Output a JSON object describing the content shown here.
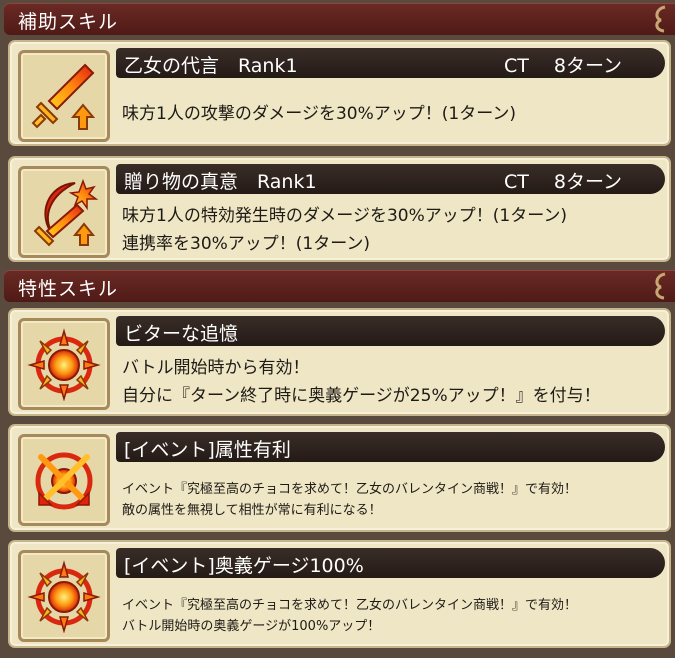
{
  "support_section": {
    "title": "補助スキル",
    "skills": [
      {
        "name": "乙女の代言　Rank1",
        "ct": "CT　 8ターン",
        "icon": "sword-up-icon",
        "description": [
          "味方1人の攻撃のダメージを30%アップ！(1ターン)"
        ]
      },
      {
        "name": "贈り物の真意　Rank1",
        "ct": "CT　 8ターン",
        "icon": "crescent-sword-burst-icon",
        "description": [
          "味方1人の特効発生時のダメージを30%アップ！(1ターン)",
          "連携率を30%アップ！(1ターン)"
        ]
      }
    ]
  },
  "trait_section": {
    "title": "特性スキル",
    "skills": [
      {
        "name": "ビターな追憶",
        "icon": "flame-emblem-icon",
        "description": [
          "バトル開始時から有効！",
          "自分に『ターン終了時に奥義ゲージが25%アップ！』を付与！"
        ]
      },
      {
        "name": "[イベント]属性有利",
        "icon": "crossed-arrows-emblem-icon",
        "description": [
          "イベント『究極至高のチョコを求めて！乙女のバレンタイン商戦！』で有効！",
          "敵の属性を無視して相性が常に有利になる！"
        ]
      },
      {
        "name": "[イベント]奥義ゲージ100%",
        "icon": "flame-emblem-icon",
        "description": [
          "イベント『究極至高のチョコを求めて！乙女のバレンタイン商戦！』で有効！",
          "バトル開始時の奥義ゲージが100%アップ！"
        ]
      }
    ]
  }
}
